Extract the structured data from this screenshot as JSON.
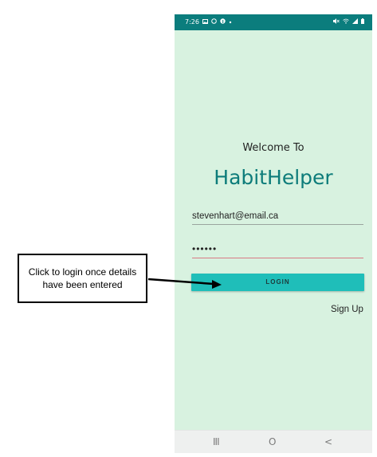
{
  "status_bar": {
    "time": "7:26",
    "left_icons": [
      "gallery-icon",
      "whatsapp-icon",
      "facebook-icon",
      "dot-icon"
    ],
    "right_icons": [
      "mute-icon",
      "wifi-icon",
      "signal-icon",
      "battery-icon"
    ]
  },
  "screen": {
    "welcome_text": "Welcome To",
    "app_title": "HabitHelper",
    "email_value": "stevenhart@email.ca",
    "password_value": "••••••",
    "login_label": "LOGIN",
    "signup_label": "Sign Up"
  },
  "nav_bar": {
    "recent_glyph": "III",
    "home_glyph": "O",
    "back_glyph": "<"
  },
  "annotation": {
    "text": "Click to login once details have been entered"
  },
  "colors": {
    "status_bar": "#0b7d7d",
    "background": "#d8f2e0",
    "title": "#0d7c7a",
    "button": "#1fbeb9",
    "password_underline": "#d87a84"
  }
}
